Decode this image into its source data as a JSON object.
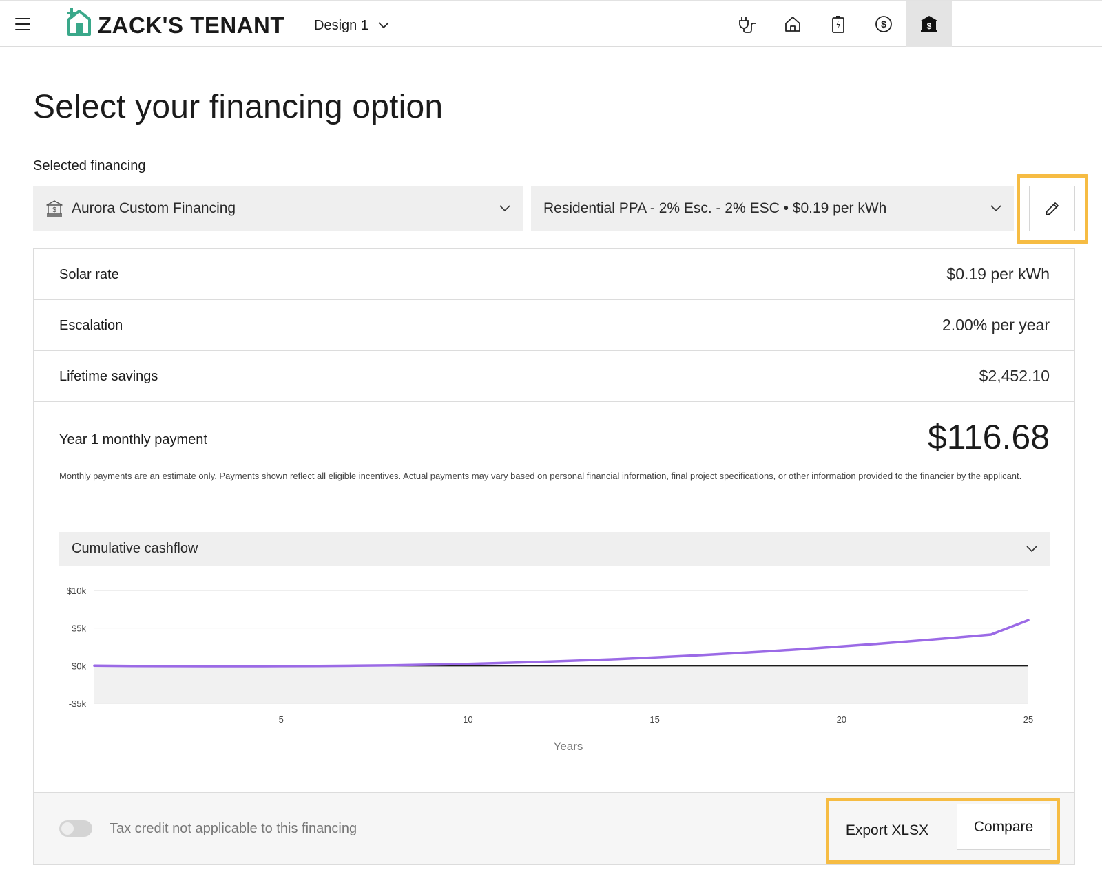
{
  "header": {
    "brand": "ZACK'S TENANT",
    "design_label": "Design 1",
    "nav": [
      {
        "icon": "plug-icon"
      },
      {
        "icon": "home-icon"
      },
      {
        "icon": "battery-icon"
      },
      {
        "icon": "dollar-circle-icon"
      },
      {
        "icon": "bank-dollar-icon",
        "active": true
      }
    ]
  },
  "page": {
    "title": "Select your financing option",
    "selected_label": "Selected financing"
  },
  "financing": {
    "financier": "Aurora Custom Financing",
    "product": "Residential PPA - 2% Esc. - 2% ESC • $0.19 per kWh"
  },
  "details": {
    "solar_rate_label": "Solar rate",
    "solar_rate_value": "$0.19 per kWh",
    "escalation_label": "Escalation",
    "escalation_value": "2.00% per year",
    "savings_label": "Lifetime savings",
    "savings_value": "$2,452.10",
    "payment_label": "Year 1 monthly payment",
    "payment_value": "$116.68",
    "disclaimer": "Monthly payments are an estimate only. Payments shown reflect all eligible incentives. Actual payments may vary based on personal financial information, final project specifications, or other information provided to the financier by the applicant."
  },
  "chart_select": "Cumulative cashflow",
  "chart_data": {
    "type": "line",
    "xlabel": "Years",
    "ylabel": "",
    "x_ticks": [
      5,
      10,
      15,
      20,
      25
    ],
    "y_ticks": [
      {
        "value": 10000,
        "label": "$10k"
      },
      {
        "value": 5000,
        "label": "$5k"
      },
      {
        "value": 0,
        "label": "$0k"
      },
      {
        "value": -5000,
        "label": "-$5k"
      }
    ],
    "xlim": [
      0,
      25
    ],
    "ylim": [
      -5000,
      10000
    ],
    "grid": true,
    "series": [
      {
        "color": "#9b6ae6",
        "x": [
          0,
          1,
          2,
          3,
          4,
          5,
          6,
          7,
          8,
          9,
          10,
          11,
          12,
          13,
          14,
          15,
          16,
          17,
          18,
          19,
          20,
          21,
          22,
          23,
          24,
          25
        ],
        "values": [
          0,
          -30,
          -50,
          -60,
          -60,
          -50,
          -30,
          0,
          60,
          140,
          240,
          370,
          520,
          690,
          880,
          1100,
          1350,
          1620,
          1910,
          2230,
          2560,
          2920,
          3310,
          3720,
          4150,
          6050
        ]
      }
    ]
  },
  "footer": {
    "tax_credit_label": "Tax credit not applicable to this financing",
    "export_label": "Export XLSX",
    "compare_label": "Compare"
  }
}
